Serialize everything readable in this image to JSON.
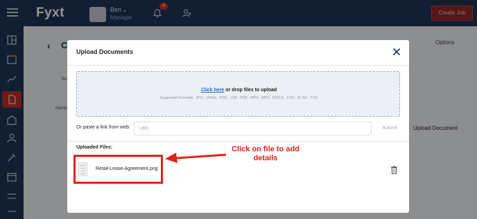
{
  "app": {
    "logo": "Fyxt",
    "account_name": "Ben",
    "account_role": "Manager",
    "notification_count": "8",
    "create_button": "Create Job"
  },
  "page": {
    "title_fragment": "C",
    "options_label": "Options",
    "upload_document_label": "Upload Document",
    "tab_fragment": "Ten",
    "name_fragment": "Mainte"
  },
  "modal": {
    "title": "Upload Documents",
    "dropzone": {
      "link_text": "Click here",
      "rest_text": " or drop files to upload",
      "supported_formats": "Supported Formats: .JPG, .JPEG, .PNG, .GIF, .PDF, .MP4, .MP3, .DOCX, .CSV, .XLSX, .TSV"
    },
    "link_label": "Or paste a link from web:",
    "url_placeholder": "URL",
    "url_value": "",
    "submit_label": "Submit",
    "uploaded_label": "Uploaded Files:",
    "files": [
      {
        "name": "Retail-Lease-Agreement.png"
      }
    ]
  },
  "annotation": {
    "line1": "Click on file to add",
    "line2": "details",
    "color": "#e2231a"
  },
  "colors": {
    "navy": "#1f3457",
    "link_blue": "#1f6fc7",
    "accent_red": "#b8322c"
  }
}
